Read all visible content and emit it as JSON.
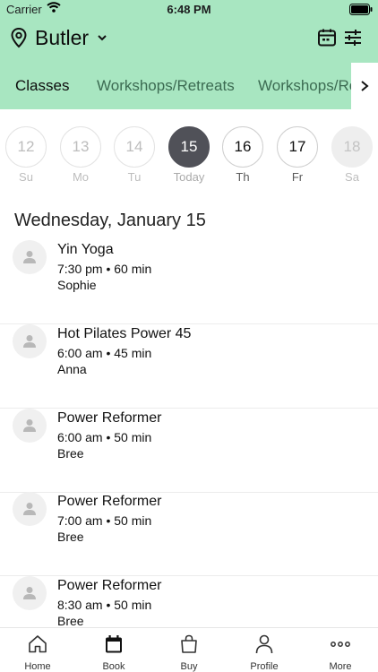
{
  "status_bar": {
    "carrier": "Carrier",
    "time": "6:48 PM"
  },
  "header": {
    "location": "Butler"
  },
  "tabs": [
    "Classes",
    "Workshops/Retreats",
    "Workshops/Retreats"
  ],
  "days": [
    {
      "num": "12",
      "label": "Su",
      "state": "past"
    },
    {
      "num": "13",
      "label": "Mo",
      "state": "past"
    },
    {
      "num": "14",
      "label": "Tu",
      "state": "past"
    },
    {
      "num": "15",
      "label": "Today",
      "state": "selected"
    },
    {
      "num": "16",
      "label": "Th",
      "state": "upcoming"
    },
    {
      "num": "17",
      "label": "Fr",
      "state": "upcoming"
    },
    {
      "num": "18",
      "label": "Sa",
      "state": "closed"
    }
  ],
  "date_heading": "Wednesday, January 15",
  "classes": [
    {
      "name": "Yin Yoga",
      "time": "7:30 pm • 60 min",
      "teacher": "Sophie"
    },
    {
      "name": "Hot Pilates Power 45",
      "time": "6:00 am • 45 min",
      "teacher": "Anna"
    },
    {
      "name": "Power Reformer",
      "time": "6:00 am • 50 min",
      "teacher": "Bree"
    },
    {
      "name": "Power Reformer",
      "time": "7:00 am • 50 min",
      "teacher": "Bree"
    },
    {
      "name": "Power Reformer",
      "time": "8:30 am • 50 min",
      "teacher": "Bree"
    }
  ],
  "nav": [
    "Home",
    "Book",
    "Buy",
    "Profile",
    "More"
  ],
  "colors": {
    "header": "#a8e6c1",
    "selected_day": "#505158"
  }
}
